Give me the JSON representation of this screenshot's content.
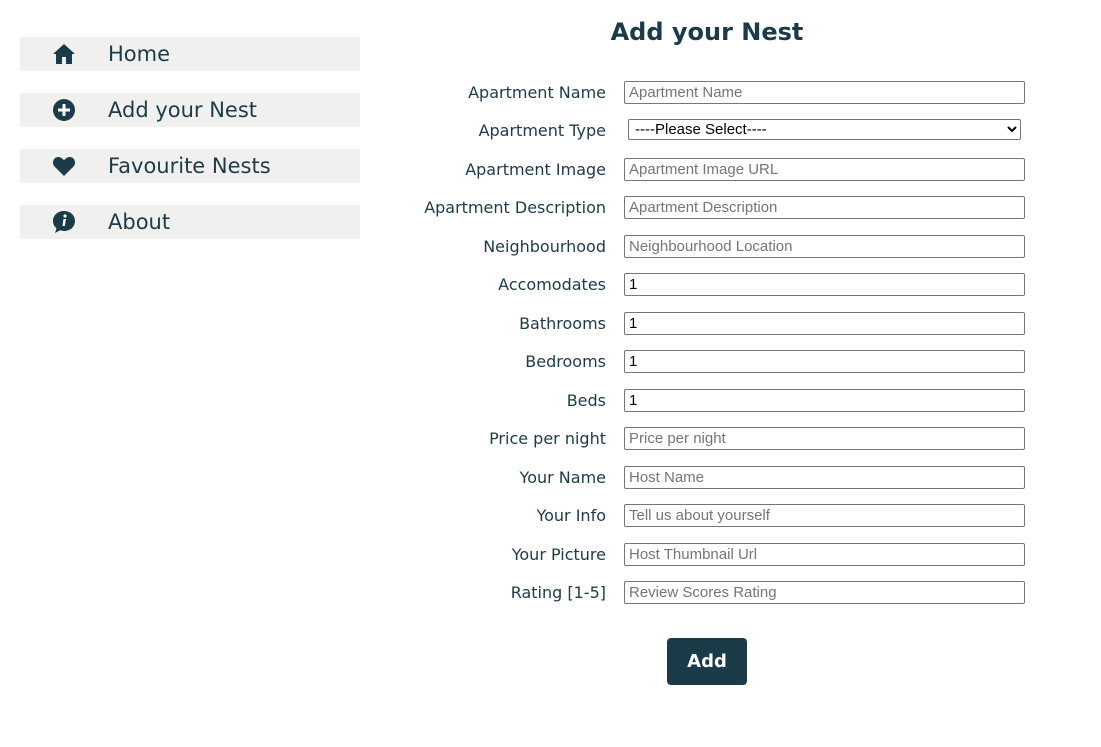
{
  "sidebar": {
    "items": [
      {
        "label": "Home",
        "icon": "home-icon"
      },
      {
        "label": "Add your Nest",
        "icon": "plus-circle-icon"
      },
      {
        "label": "Favourite Nests",
        "icon": "heart-icon"
      },
      {
        "label": "About",
        "icon": "info-speech-bubble-icon"
      }
    ]
  },
  "form": {
    "title": "Add your Nest",
    "apartment_name": {
      "label": "Apartment Name",
      "placeholder": "Apartment Name",
      "value": ""
    },
    "apartment_type": {
      "label": "Apartment Type",
      "selected": "----Please Select----"
    },
    "apartment_image": {
      "label": "Apartment Image",
      "placeholder": "Apartment Image URL",
      "value": ""
    },
    "apartment_description": {
      "label": "Apartment Description",
      "placeholder": "Apartment Description",
      "value": ""
    },
    "neighbourhood": {
      "label": "Neighbourhood",
      "placeholder": "Neighbourhood Location",
      "value": ""
    },
    "accomodates": {
      "label": "Accomodates",
      "value": "1"
    },
    "bathrooms": {
      "label": "Bathrooms",
      "value": "1"
    },
    "bedrooms": {
      "label": "Bedrooms",
      "value": "1"
    },
    "beds": {
      "label": "Beds",
      "value": "1"
    },
    "price": {
      "label": "Price per night",
      "placeholder": "Price per night",
      "value": ""
    },
    "your_name": {
      "label": "Your Name",
      "placeholder": "Host Name",
      "value": ""
    },
    "your_info": {
      "label": "Your Info",
      "placeholder": "Tell us about yourself",
      "value": ""
    },
    "your_picture": {
      "label": "Your Picture",
      "placeholder": "Host Thumbnail Url",
      "value": ""
    },
    "rating": {
      "label": "Rating [1-5]",
      "placeholder": "Review Scores Rating",
      "value": ""
    },
    "submit_label": "Add"
  },
  "colors": {
    "primary": "#1b3b48",
    "sidebar_item_bg": "#f0f1ef",
    "background": "#ffffff"
  }
}
